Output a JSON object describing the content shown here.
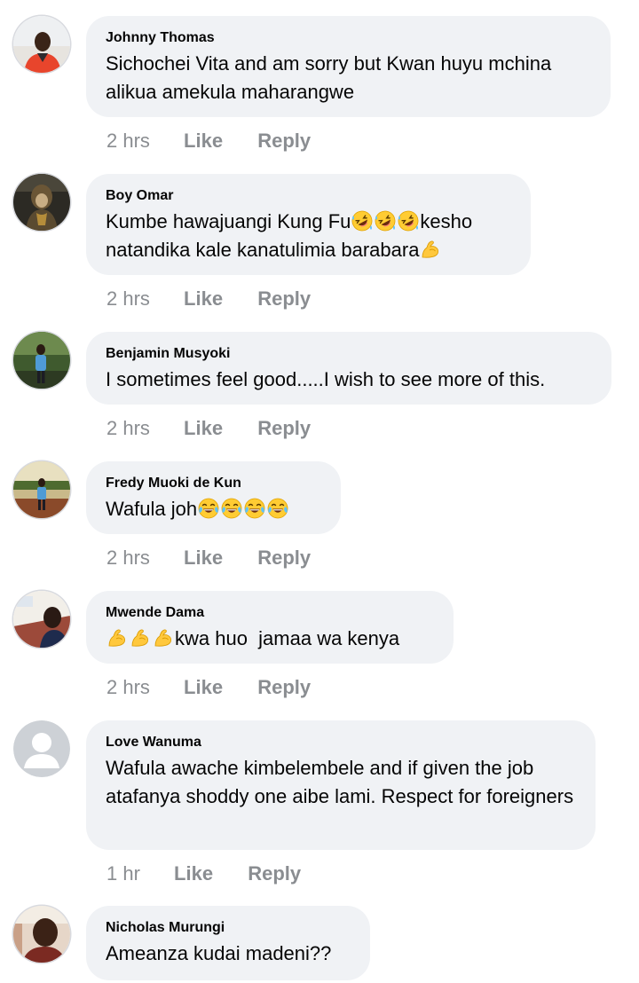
{
  "comments": [
    {
      "author": "Johnny Thomas",
      "text": "Sichochei Vita and am sorry but Kwan huyu mchina alikua amekula maharangwe",
      "time": "2 hrs",
      "like": "Like",
      "reply": "Reply"
    },
    {
      "author": "Boy Omar",
      "text_parts": [
        "Kumbe hawajuangi Kung Fu",
        "kesho natandika kale kanatulimia barabara"
      ],
      "time": "2 hrs",
      "like": "Like",
      "reply": "Reply"
    },
    {
      "author": "Benjamin Musyoki",
      "text": "I sometimes feel good.....I wish to see more of this.",
      "time": "2 hrs",
      "like": "Like",
      "reply": "Reply"
    },
    {
      "author": "Fredy Muoki de Kun",
      "text": "Wafula joh",
      "time": "2 hrs",
      "like": "Like",
      "reply": "Reply"
    },
    {
      "author": "Mwende Dama",
      "text": "kwa huo  jamaa wa kenya",
      "time": "2 hrs",
      "like": "Like",
      "reply": "Reply"
    },
    {
      "author": "Love Wanuma",
      "text": "Wafula awache kimbelembele and if given the job atafanya shoddy one aibe lami. Respect for foreigners",
      "time": "1 hr",
      "like": "Like",
      "reply": "Reply"
    },
    {
      "author": "Nicholas Murungi",
      "text": "Ameanza kudai madeni??"
    }
  ],
  "icons": {
    "rofl": "rolling-on-floor-laughing-emoji",
    "joy": "face-with-tears-of-joy-emoji",
    "flex": "flexed-biceps-emoji",
    "default_avatar": "default-profile-avatar"
  },
  "colors": {
    "bubble": "#f0f2f5",
    "meta_text": "#8a8d91",
    "text": "#050505"
  }
}
